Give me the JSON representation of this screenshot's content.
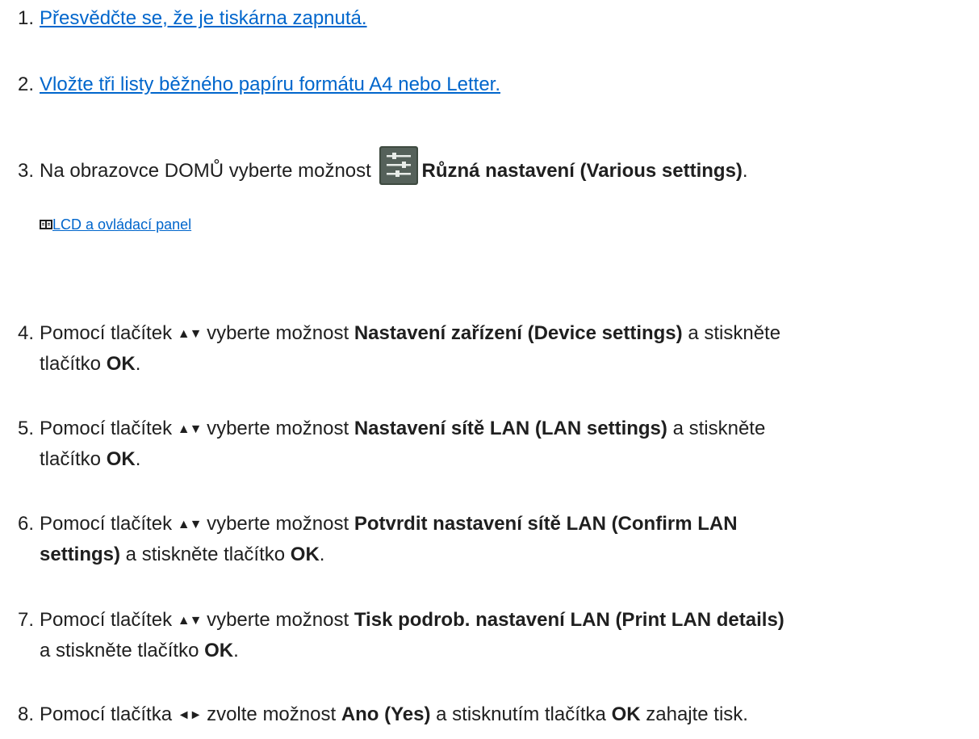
{
  "steps": [
    {
      "num": "1.",
      "link": "Přesvědčte se, že je tiskárna zapnutá."
    },
    {
      "num": "2.",
      "link": "Vložte tři listy běžného papíru formátu A4 nebo Letter."
    },
    {
      "num": "3.",
      "pre": "Na obrazovce DOMŮ vyberte možnost ",
      "bold": "Různá nastavení (Various settings)",
      "post": ".",
      "icon": "settings-sliders-icon",
      "sublink": "LCD a ovládací panel"
    },
    {
      "num": "4.",
      "pre": "Pomocí tlačítek ",
      "arrows": "▲▼",
      "mid": " vyberte možnost ",
      "bold": "Nastavení zařízení (Device settings)",
      "post": " a stiskněte",
      "line2_pre": "tlačítko ",
      "line2_bold": "OK",
      "line2_post": "."
    },
    {
      "num": "5.",
      "pre": "Pomocí tlačítek ",
      "arrows": "▲▼",
      "mid": " vyberte možnost ",
      "bold": "Nastavení sítě LAN (LAN settings)",
      "post": " a stiskněte",
      "line2_pre": "tlačítko ",
      "line2_bold": "OK",
      "line2_post": "."
    },
    {
      "num": "6.",
      "pre": "Pomocí tlačítek ",
      "arrows": "▲▼",
      "mid": " vyberte možnost ",
      "bold": "Potvrdit nastavení sítě LAN (Confirm LAN",
      "line2_bold_a": "settings)",
      "line2_pre": " a stiskněte tlačítko ",
      "line2_bold": "OK",
      "line2_post": "."
    },
    {
      "num": "7.",
      "pre": "Pomocí tlačítek ",
      "arrows": "▲▼",
      "mid": " vyberte možnost ",
      "bold": "Tisk podrob. nastavení LAN (Print LAN details)",
      "line2_pre": "a stiskněte tlačítko ",
      "line2_bold": "OK",
      "line2_post": "."
    },
    {
      "num": "8.",
      "pre": "Pomocí tlačítka ",
      "arrows": "◄►",
      "mid": " zvolte možnost ",
      "bold": "Ano (Yes)",
      "post": " a stisknutím tlačítka ",
      "bold2": "OK",
      "post2": " zahajte tisk."
    }
  ],
  "colors": {
    "link": "#0066cc",
    "text": "#1f1f1f"
  }
}
